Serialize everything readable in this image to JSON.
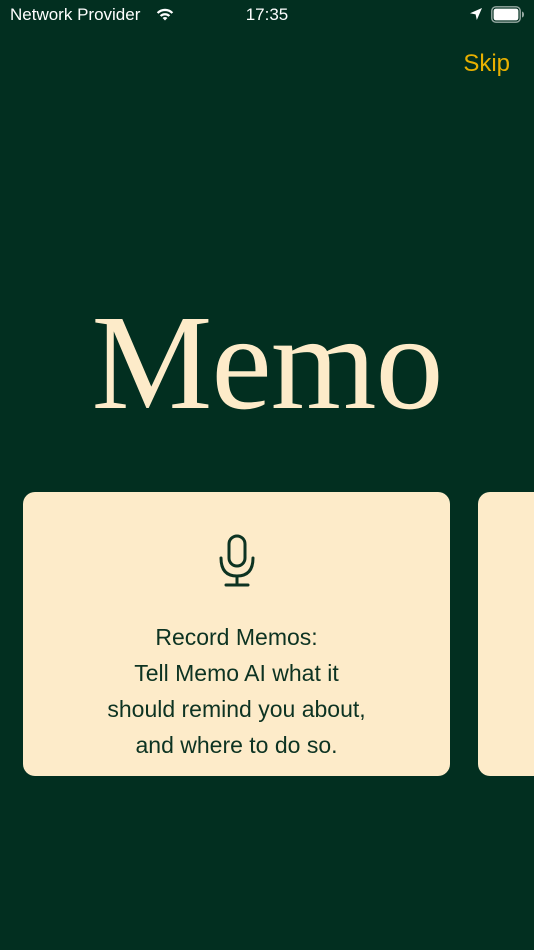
{
  "status_bar": {
    "carrier": "Network Provider",
    "time": "17:35"
  },
  "header": {
    "skip_label": "Skip"
  },
  "logo": {
    "title": "Memo"
  },
  "onboarding_card": {
    "icon": "microphone-icon",
    "lines": [
      "Record Memos:",
      "Tell Memo AI what it",
      "should remind you about,",
      "and where to do so."
    ]
  },
  "colors": {
    "background": "#022f20",
    "card": "#fdebc9",
    "accent": "#e8b000",
    "text_dark": "#0d3322"
  }
}
